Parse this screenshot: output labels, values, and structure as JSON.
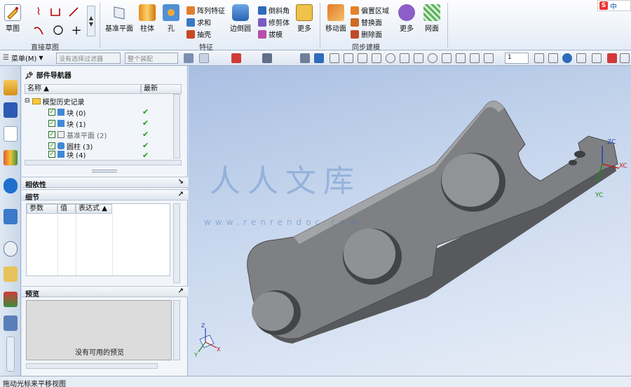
{
  "ribbon": {
    "sketch_label": "草图",
    "datum_plane_label": "基准平面",
    "cylinder_label": "柱体",
    "hole_label": "孔",
    "pattern_label": "阵列特征",
    "sum_label": "求和",
    "shell_label": "抽壳",
    "edge_blend_label": "边倒圆",
    "chamfer_label": "倒斜角",
    "trim_body_label": "修剪体",
    "draft_label": "拔模",
    "more_feature_label": "更多",
    "move_face_label": "移动面",
    "offset_region_label": "偏置区域",
    "replace_face_label": "替换面",
    "delete_face_label": "删除面",
    "more_sync_label": "更多",
    "mesh_surface_label": "网面",
    "direct_sketch_group": "直接草图",
    "feature_group": "特征",
    "sync_group": "同步建模",
    "ime_badge": "S",
    "ime_text": "中"
  },
  "toolbar2": {
    "menu_label": "菜单(M)",
    "filter_value": "没有选择过滤器",
    "scope_value": "整个装配",
    "layer_value": "1"
  },
  "navigator": {
    "title": "部件导航器",
    "col_name": "名称",
    "col_latest": "最新",
    "history_label": "模型历史记录",
    "items": [
      {
        "label": "块 (0)"
      },
      {
        "label": "块 (1)"
      },
      {
        "label": "基准平面 (2)"
      },
      {
        "label": "圆柱 (3)"
      },
      {
        "label": "块 (4)"
      }
    ],
    "dependency_label": "相依性",
    "detail_label": "细节",
    "detail_cols": [
      "参数",
      "值",
      "表达式"
    ],
    "preview_label": "预览",
    "preview_empty": "没有可用的预览"
  },
  "viewport": {
    "axis_zc": "ZC",
    "axis_xc": "XC",
    "axis_yc": "YC",
    "axis_z": "Z",
    "axis_x": "X",
    "axis_y": "Y",
    "watermark_title": "人人文库",
    "watermark_url": "www.renrendoc.com"
  },
  "status": {
    "text": "拖动光标来平移视图"
  },
  "colors": {
    "part_fill": "#7d7e80",
    "part_top": "#9a9b9d",
    "part_side": "#5c5d60",
    "accent": "#1e5aa8",
    "check_green": "#1aa01a"
  }
}
